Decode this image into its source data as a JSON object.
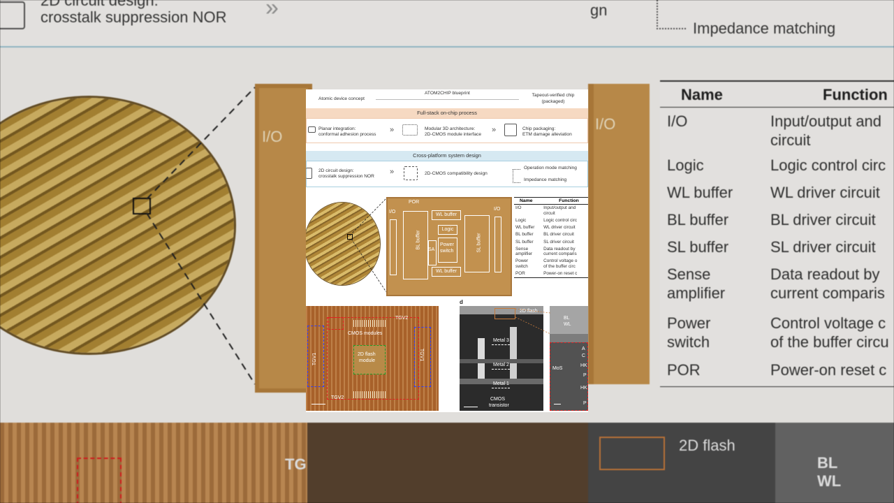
{
  "background": {
    "banner_left": [
      "2D circuit design:",
      "crosstalk suppression NOR"
    ],
    "banner_right_fragment": "gn",
    "banner_right": "Impedance matching",
    "chip_io": "I/O",
    "table_header_name": "Name",
    "table_header_function": "Function",
    "table_rows": [
      {
        "name": [
          "I/O"
        ],
        "function": [
          "Input/output and",
          "circuit"
        ]
      },
      {
        "name": [
          "Logic"
        ],
        "function": [
          "Logic control circ"
        ]
      },
      {
        "name": [
          "WL buffer"
        ],
        "function": [
          "WL driver circuit"
        ]
      },
      {
        "name": [
          "BL buffer"
        ],
        "function": [
          "BL driver circuit"
        ]
      },
      {
        "name": [
          "SL buffer"
        ],
        "function": [
          "SL driver circuit"
        ]
      },
      {
        "name": [
          "Sense",
          "amplifier"
        ],
        "function": [
          "Data readout by",
          "current comparis"
        ]
      },
      {
        "name": [
          "Power",
          "switch"
        ],
        "function": [
          "Control voltage c",
          "of the buffer circu"
        ]
      },
      {
        "name": [
          "POR"
        ],
        "function": [
          "Power-on reset c"
        ]
      }
    ],
    "bottom_left_label": "TG",
    "bottom_mid_label": "2D flash",
    "bottom_right_bl": "BL",
    "bottom_right_wl": "WL"
  },
  "figure": {
    "top": {
      "blueprint": "ATOM2CHIP blueprint",
      "left": "Atomic device concept",
      "right": [
        "Tapeout-verified chip",
        "(packaged)"
      ]
    },
    "process": {
      "title": "Full-stack on-chip process",
      "items": [
        [
          "Planar integration:",
          "conformal adhesion process"
        ],
        [
          "Modular 3D architecture:",
          "2D-CMOS module interface"
        ],
        [
          "Chip packaging:",
          "ETM damage alleviation"
        ]
      ]
    },
    "system": {
      "title": "Cross-platform system design",
      "item1": [
        "2D circuit design:",
        "crosstalk suppression NOR"
      ],
      "item2": "2D-CMOS compatibility design",
      "item3a": "Operation mode matching",
      "item3b": "Impedance matching"
    },
    "chip": {
      "por": "POR",
      "io_left": "I/O",
      "io_right": "I/O",
      "wl_top": "WL buffer",
      "wl_bottom": "WL buffer",
      "logic": "Logic",
      "power": [
        "Power",
        "switch"
      ],
      "bl": "BL buffer",
      "sl": "SL buffer",
      "sa": "SA"
    },
    "table": {
      "header_name": "Name",
      "header_function": "Function",
      "rows": [
        {
          "name": [
            "I/O"
          ],
          "function": [
            "Input/output and",
            "circuit"
          ]
        },
        {
          "name": [
            "Logic"
          ],
          "function": [
            "Logic control circ"
          ]
        },
        {
          "name": [
            "WL buffer"
          ],
          "function": [
            "WL driver circuit"
          ]
        },
        {
          "name": [
            "BL buffer"
          ],
          "function": [
            "BL driver circuit"
          ]
        },
        {
          "name": [
            "SL buffer"
          ],
          "function": [
            "SL driver circuit"
          ]
        },
        {
          "name": [
            "Sense",
            "amplifier"
          ],
          "function": [
            "Data readout by",
            "current comparis"
          ]
        },
        {
          "name": [
            "Power",
            "switch"
          ],
          "function": [
            "Control voltage o",
            "of the buffer circ"
          ]
        },
        {
          "name": [
            "POR"
          ],
          "function": [
            "Power-on reset c"
          ]
        }
      ]
    },
    "panel_c": {
      "tgv2_top": "TGV2",
      "tgv2_bottom": "TGV2",
      "tgv1_left": "TGV1",
      "tgv1_right": "TGV1",
      "cmos_modules": "CMOS modules",
      "flash_module": [
        "2D flash",
        "module"
      ]
    },
    "panel_d": {
      "label": "d",
      "flash": "2D flash",
      "metal3": "Metal 3",
      "metal2": "Metal 2",
      "metal1": "Metal 1",
      "cmos": [
        "CMOS",
        "transistor"
      ],
      "bl": "BL",
      "wl": "WL",
      "mos2": "MoS",
      "hk1": "HK",
      "hk2": "HK",
      "au": "A",
      "c": "C",
      "p1": "P",
      "p2": "P"
    }
  }
}
